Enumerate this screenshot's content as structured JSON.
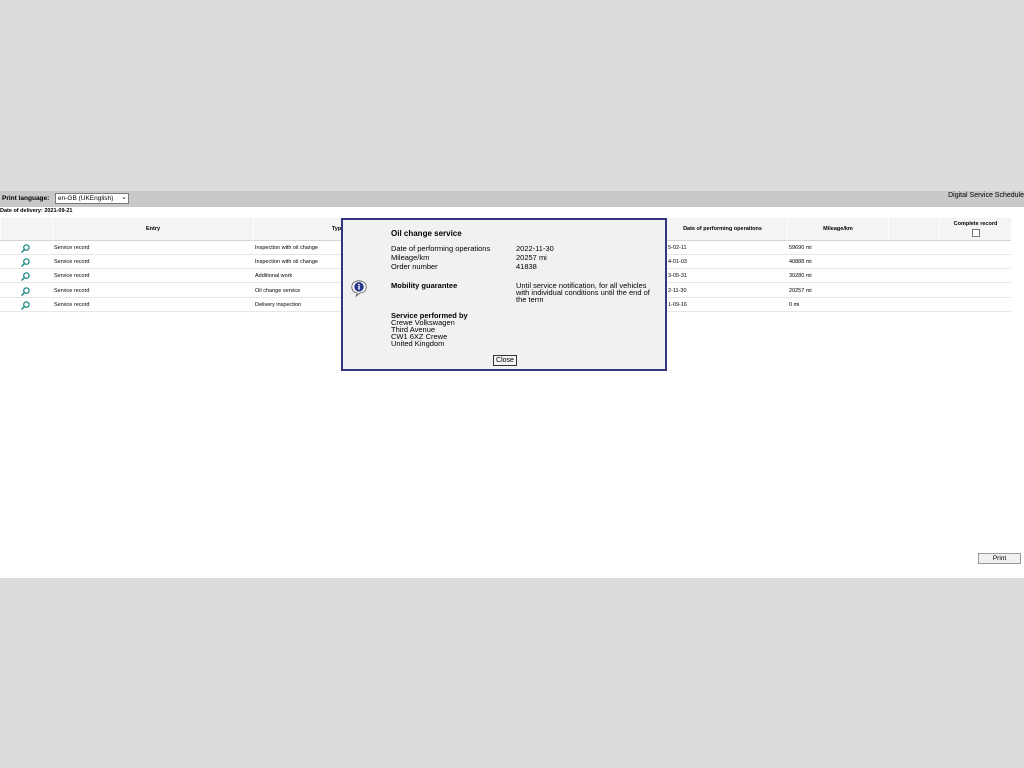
{
  "header": {
    "print_language_label": "Print language:",
    "print_language_value": "en-GB (UKEnglish)",
    "app_title": "Digital Service Schedule"
  },
  "delivery": {
    "label": "Date of delivery: 2021-09-21"
  },
  "table": {
    "columns": {
      "entry": "Entry",
      "type": "Typ",
      "date": "Date of performing operations",
      "mileage": "Mileage/km",
      "complete": "Complete record"
    },
    "rows": [
      {
        "entry": "Service record",
        "type": "Inspection with oil change",
        "date": "5-02-11",
        "mileage": "59690 mi"
      },
      {
        "entry": "Service record",
        "type": "Inspection with oil change",
        "date": "4-01-03",
        "mileage": "40888 mi"
      },
      {
        "entry": "Service record",
        "type": "Additional work",
        "date": "3-05-31",
        "mileage": "30280 mi"
      },
      {
        "entry": "Service record",
        "type": "Oil change service",
        "date": "2-11-30",
        "mileage": "20257 mi"
      },
      {
        "entry": "Service record",
        "type": "Delivery inspection",
        "date": "1-09-16",
        "mileage": "0 mi"
      }
    ]
  },
  "print_button": "Print",
  "dialog": {
    "title": "Oil change service",
    "date_label": "Date of performing operations",
    "date_value": "2022-11-30",
    "mileage_label": "Mileage/km",
    "mileage_value": "20257 mi",
    "order_label": "Order number",
    "order_value": "41838",
    "mobility_label": "Mobility guarantee",
    "mobility_line1": "Until service notification, for all vehicles",
    "mobility_line2": "with individual conditions until the end of",
    "mobility_line3": "the term",
    "service_label": "Service performed by",
    "service_line1": "Crewe Volkswagen",
    "service_line2": "Third Avenue",
    "service_line3": "CW1 6XZ Crewe",
    "service_line4": "United Kingdom",
    "close_button": "Close"
  },
  "icons": {
    "row_icon": "magnifier-icon",
    "dialog_icon": "info-icon",
    "chevron": "chevron-down-icon"
  },
  "colors": {
    "dialog_border": "#35357f",
    "magnifier": "#1f8a84",
    "header_bar": "#c8c8c8"
  }
}
